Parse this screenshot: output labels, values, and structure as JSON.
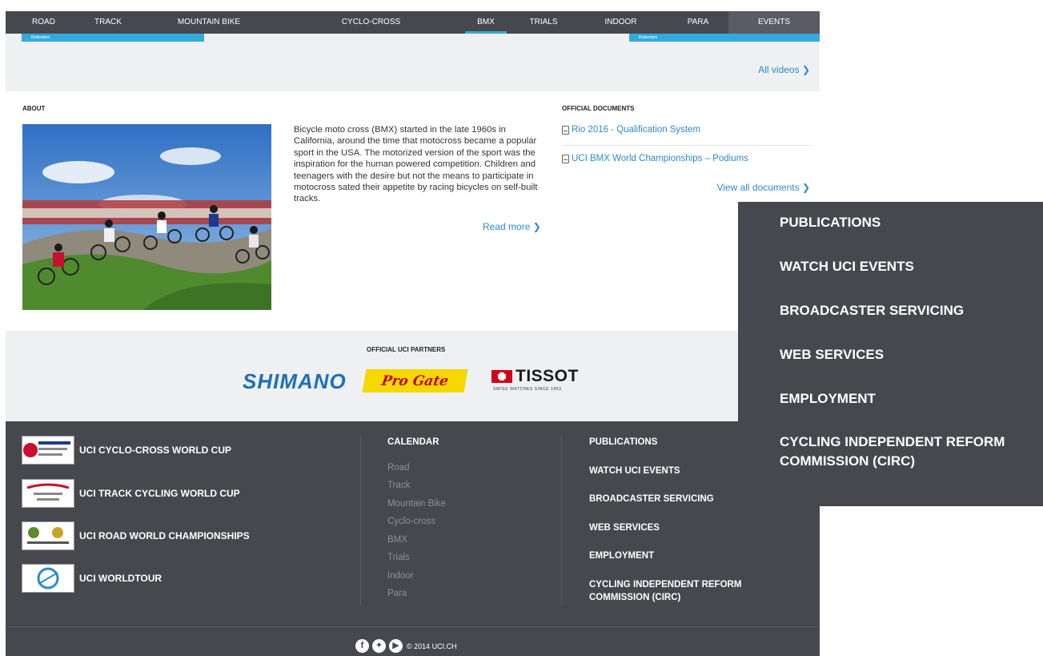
{
  "nav": {
    "items": [
      "ROAD",
      "TRACK",
      "MOUNTAIN BIKE",
      "CYCLO-CROSS",
      "BMX",
      "TRIALS",
      "INDOOR",
      "PARA",
      "EVENTS"
    ],
    "active": "BMX"
  },
  "videos": {
    "tabs": [
      "Rotterdam",
      "Rotterdam"
    ],
    "all_videos_label": "All videos ❯"
  },
  "about": {
    "title": "ABOUT",
    "text": "Bicycle moto cross (BMX) started in the late 1960s in California, around the time that motocross became a popular sport in the USA. The motorized version of the sport was the inspiration for the human powered competition. Children and teenagers with the desire but not the means to participate in motocross sated their appetite by racing bicycles on self-built tracks.",
    "read_more": "Read more ❯"
  },
  "documents": {
    "title": "OFFICIAL DOCUMENTS",
    "items": [
      "Rio 2016 - Qualification System",
      "UCI BMX World Championships – Podiums"
    ],
    "view_all": "View all documents ❯"
  },
  "partners": {
    "title": "OFFICIAL UCI PARTNERS",
    "logos": [
      "SHIMANO",
      "Pro Gate",
      "TISSOT"
    ],
    "tissot_tagline": "SWISS WATCHES SINCE 1853"
  },
  "footer": {
    "events": [
      "UCI CYCLO-CROSS WORLD CUP",
      "UCI TRACK CYCLING WORLD CUP",
      "UCI ROAD WORLD CHAMPIONSHIPS",
      "UCI WORLDTOUR"
    ],
    "calendar_title": "CALENDAR",
    "calendar_links": [
      "Road",
      "Track",
      "Mountain Bike",
      "Cyclo-cross",
      "BMX",
      "Trials",
      "Indoor",
      "Para"
    ],
    "links": [
      "PUBLICATIONS",
      "WATCH UCI EVENTS",
      "BROADCASTER SERVICING",
      "WEB SERVICES",
      "EMPLOYMENT",
      "CYCLING INDEPENDENT REFORM COMMISSION (CIRC)"
    ],
    "social_icons": [
      "facebook-icon",
      "twitter-icon",
      "youtube-icon"
    ],
    "copyright": "© 2014 UCI.CH"
  },
  "overlay": {
    "links": [
      "PUBLICATIONS",
      "WATCH UCI EVENTS",
      "BROADCASTER SERVICING",
      "WEB SERVICES",
      "EMPLOYMENT",
      "CYCLING INDEPENDENT REFORM COMMISSION (CIRC)"
    ]
  },
  "colors": {
    "nav_bg": "#46484e",
    "accent_blue": "#34aadc",
    "link_blue": "#2e8bc9",
    "footer_bg": "#46484e",
    "light_bg": "#eef0f2"
  }
}
